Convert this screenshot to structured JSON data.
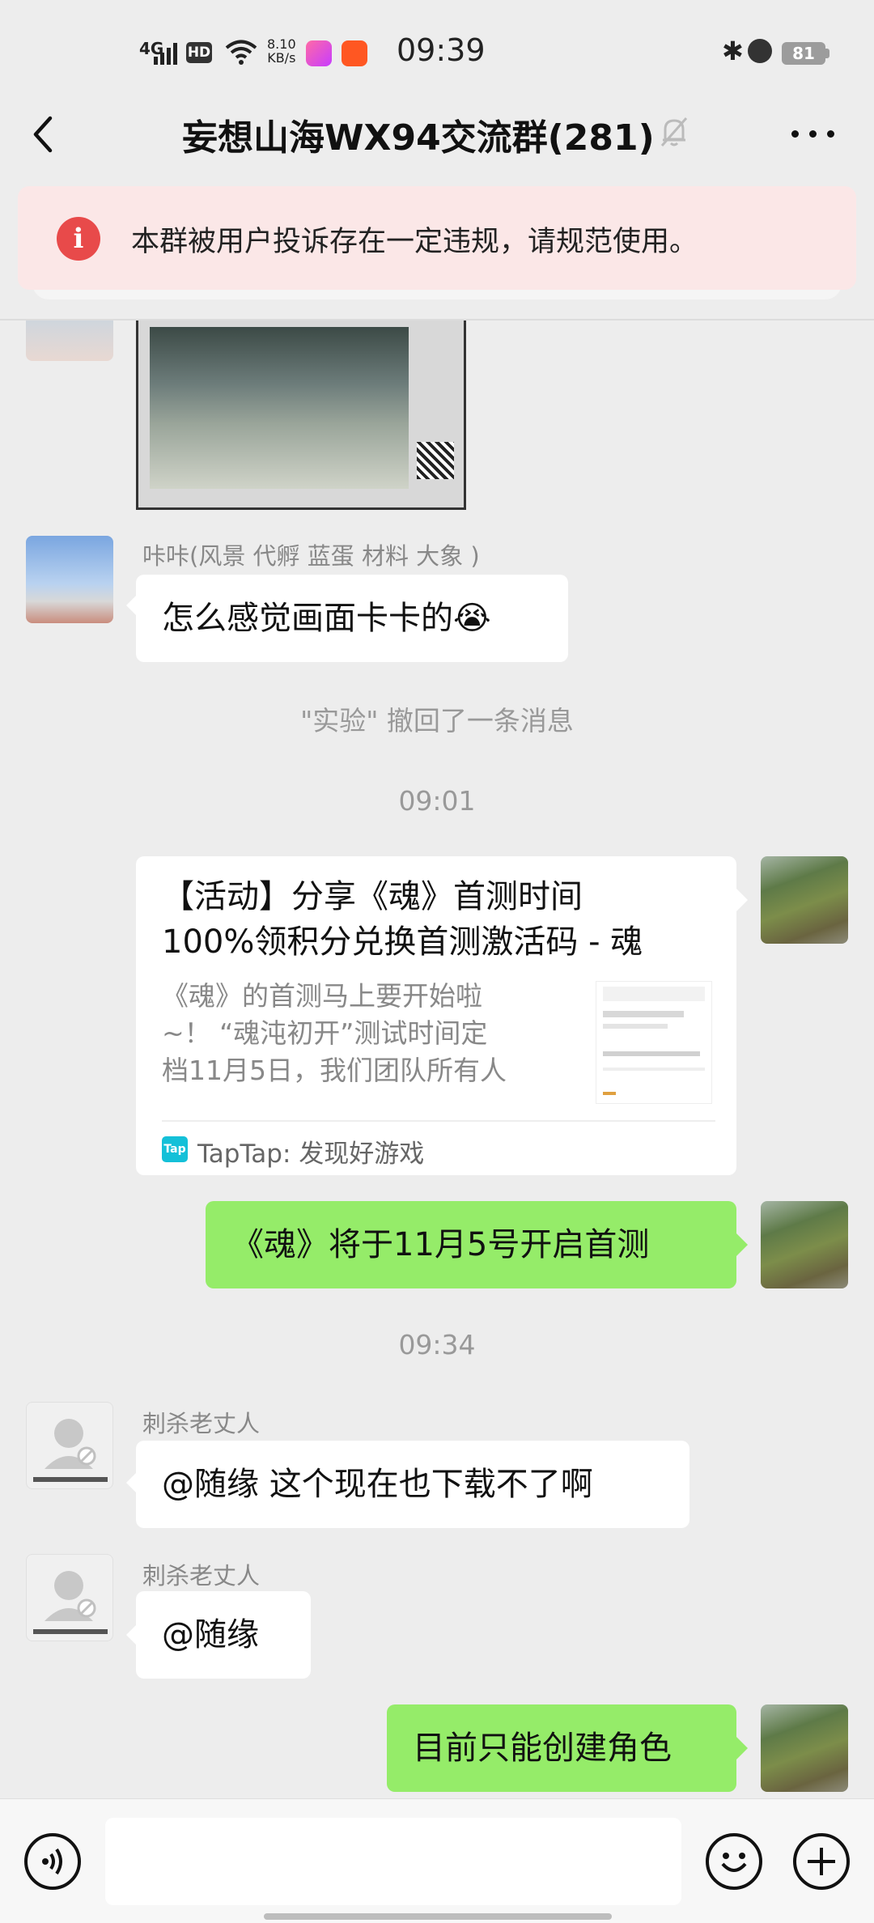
{
  "status_bar": {
    "time": "09:39",
    "signal": "4G",
    "hd": "HD",
    "speed_value": "8.10",
    "speed_unit": "KB/s",
    "battery": "81"
  },
  "header": {
    "title": "妄想山海WX94交流群(281)"
  },
  "warning": {
    "icon_text": "i",
    "text": "本群被用户投诉存在一定违规，请规范使用。"
  },
  "messages": {
    "m1": {
      "sender": "咔咔(风景 代孵 蓝蛋 材料 大象 )",
      "text": "怎么感觉画面卡卡的😭"
    },
    "recall_note": "\"实验\" 撤回了一条消息",
    "time1": "09:01",
    "card": {
      "title_line1": "【活动】分享《魂》首测时间",
      "title_line2": "100%领积分兑换首测激活码 - 魂",
      "desc_line1": "《魂》的首测马上要开始啦",
      "desc_line2": "~！ “魂沌初开”测试时间定",
      "desc_line3": "档11月5日，我们团队所有人",
      "source_icon": "Tap",
      "source": "TapTap: 发现好游戏"
    },
    "m2": {
      "text": "《魂》将于11月5号开启首测"
    },
    "time2": "09:34",
    "m3": {
      "sender": "刺杀老丈人",
      "text": "@随缘  这个现在也下载不了啊"
    },
    "m4": {
      "sender": "刺杀老丈人",
      "text": "@随缘"
    },
    "m5": {
      "text": "目前只能创建角色"
    }
  },
  "colors": {
    "my_bubble": "#95ec69",
    "warning_bg": "#fbe7e7",
    "warning_icon": "#e84a4a"
  }
}
